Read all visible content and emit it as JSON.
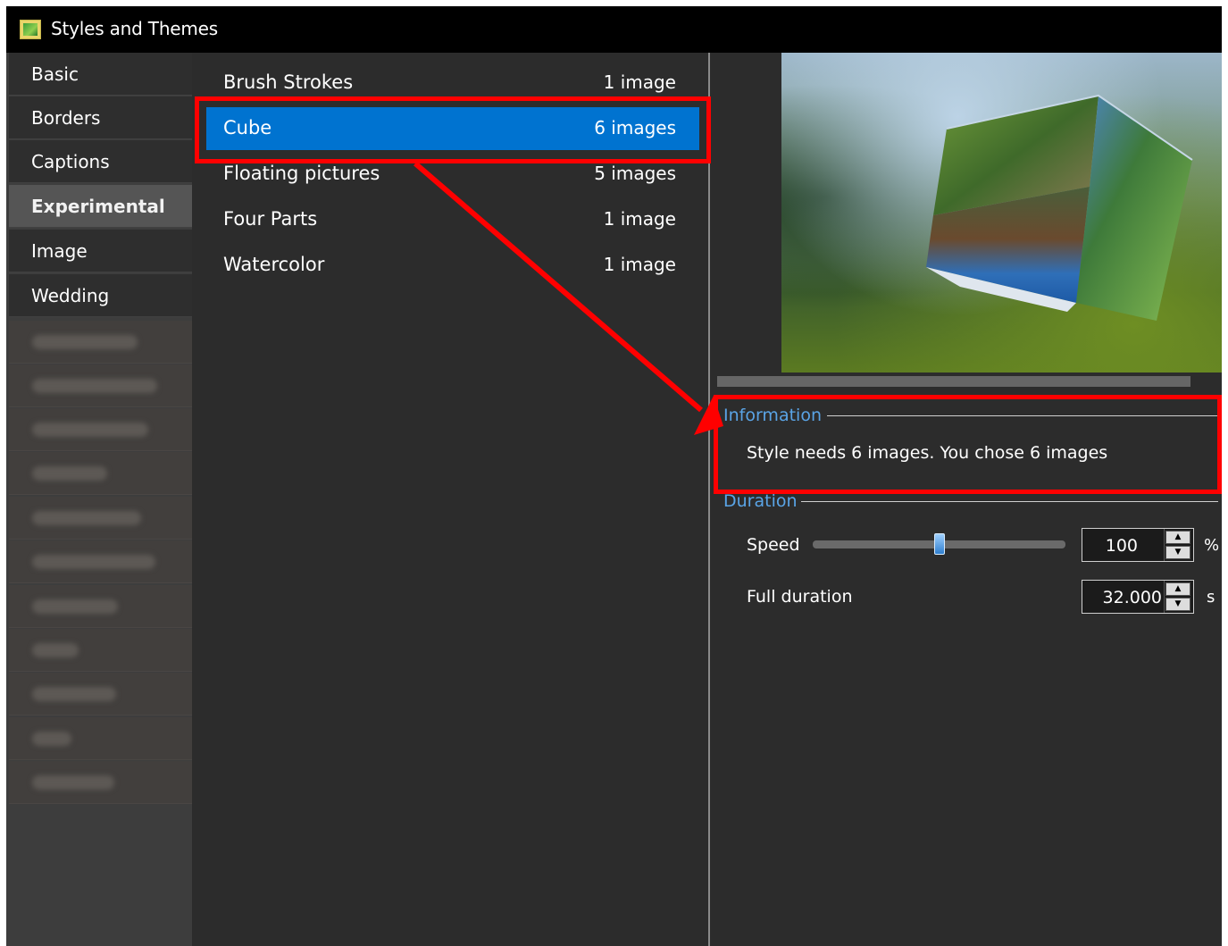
{
  "window": {
    "title": "Styles and Themes"
  },
  "categories": {
    "items": [
      {
        "label": "Basic"
      },
      {
        "label": "Borders"
      },
      {
        "label": "Captions"
      },
      {
        "label": "Experimental"
      },
      {
        "label": "Image"
      },
      {
        "label": "Wedding"
      }
    ],
    "selected": "Experimental"
  },
  "styles": {
    "items": [
      {
        "name": "Brush Strokes",
        "count": "1 image"
      },
      {
        "name": "Cube",
        "count": "6 images"
      },
      {
        "name": "Floating pictures",
        "count": "5 images"
      },
      {
        "name": "Four Parts",
        "count": "1 image"
      },
      {
        "name": "Watercolor",
        "count": "1 image"
      }
    ],
    "selected": "Cube"
  },
  "information": {
    "label": "Information",
    "text": "Style needs 6 images. You chose 6 images"
  },
  "duration": {
    "label": "Duration",
    "speed": {
      "label": "Speed",
      "value": "100",
      "unit": "%",
      "slider_fraction": 0.5
    },
    "full_duration": {
      "label": "Full duration",
      "value": "32.000",
      "unit": "s"
    }
  },
  "colors": {
    "selection": "#0073d0",
    "group_label": "#5aa4e6",
    "annotation": "#ff0000"
  },
  "icons": {
    "app": "styles-themes-icon",
    "spin_up": "arrow-up-icon",
    "spin_down": "arrow-down-icon"
  }
}
